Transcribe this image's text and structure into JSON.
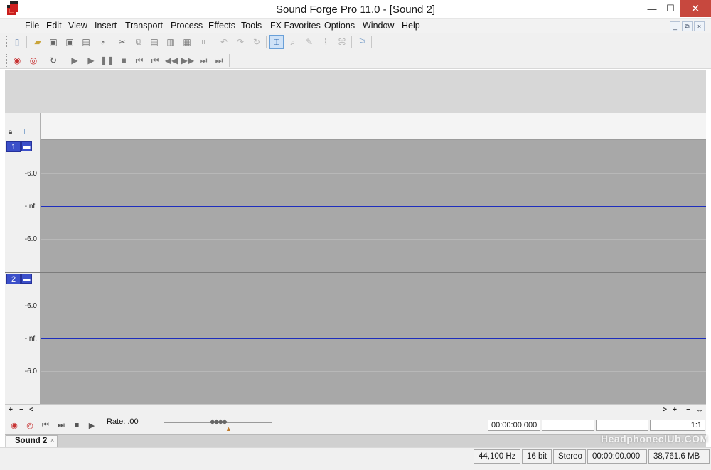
{
  "window": {
    "title": "Sound Forge Pro 11.0 - [Sound 2]",
    "minimize": "—",
    "maximize": "☐",
    "close": "✕",
    "icon": "sound-forge-app-icon"
  },
  "menu": {
    "items": [
      "File",
      "Edit",
      "View",
      "Insert",
      "Transport",
      "Process",
      "Effects",
      "Tools",
      "FX Favorites",
      "Options",
      "Window",
      "Help"
    ],
    "mdi_buttons": [
      "_",
      "⧉",
      "×"
    ]
  },
  "toolbar": {
    "standard_icons": [
      "new-icon",
      "open-icon",
      "save-icon",
      "save-as-icon",
      "render-icon",
      "properties-icon",
      "cut-icon",
      "copy-icon",
      "paste-icon",
      "paste-special-icon",
      "mix-icon",
      "crop-icon",
      "undo-icon",
      "redo-icon",
      "repeat-icon",
      "edit-tool-icon",
      "magnify-tool-icon",
      "pencil-tool-icon",
      "envelope-tool-icon",
      "event-tool-icon",
      "snap-icon"
    ],
    "transport_icons": [
      "record-icon",
      "record-arm-icon",
      "loop-icon",
      "play-all-icon",
      "play-icon",
      "pause-icon",
      "stop-icon",
      "go-to-start-icon",
      "previous-marker-icon",
      "rewind-icon",
      "fast-forward-icon",
      "next-marker-icon",
      "go-to-end-icon"
    ]
  },
  "tracks": {
    "channels": [
      {
        "number": "1",
        "labels": [
          "-6.0",
          "-Inf.",
          "-6.0"
        ]
      },
      {
        "number": "2",
        "labels": [
          "-6.0",
          "-Inf.",
          "-6.0"
        ]
      }
    ],
    "colors": {
      "baseline": "#1d2dbd",
      "waveform_bg": "#a8a8a8",
      "channel_badge": "#3b4fc9"
    }
  },
  "scrollbar": {
    "left": [
      "+",
      "−",
      "<"
    ],
    "right": [
      ">",
      "+",
      "−",
      "↔"
    ]
  },
  "transport": {
    "rate_label": "Rate: .00",
    "timecode_start": "00:00:00.000",
    "zoom_ratio": "1:1"
  },
  "document_tab": {
    "label": "Sound 2",
    "close": "×"
  },
  "status": {
    "sample_rate": "44,100 Hz",
    "bit_depth": "16 bit",
    "channels": "Stereo",
    "length": "00:00:00.000",
    "disk_space": "38,761.6 MB"
  },
  "watermark": "HeadphoneclUb.COM"
}
